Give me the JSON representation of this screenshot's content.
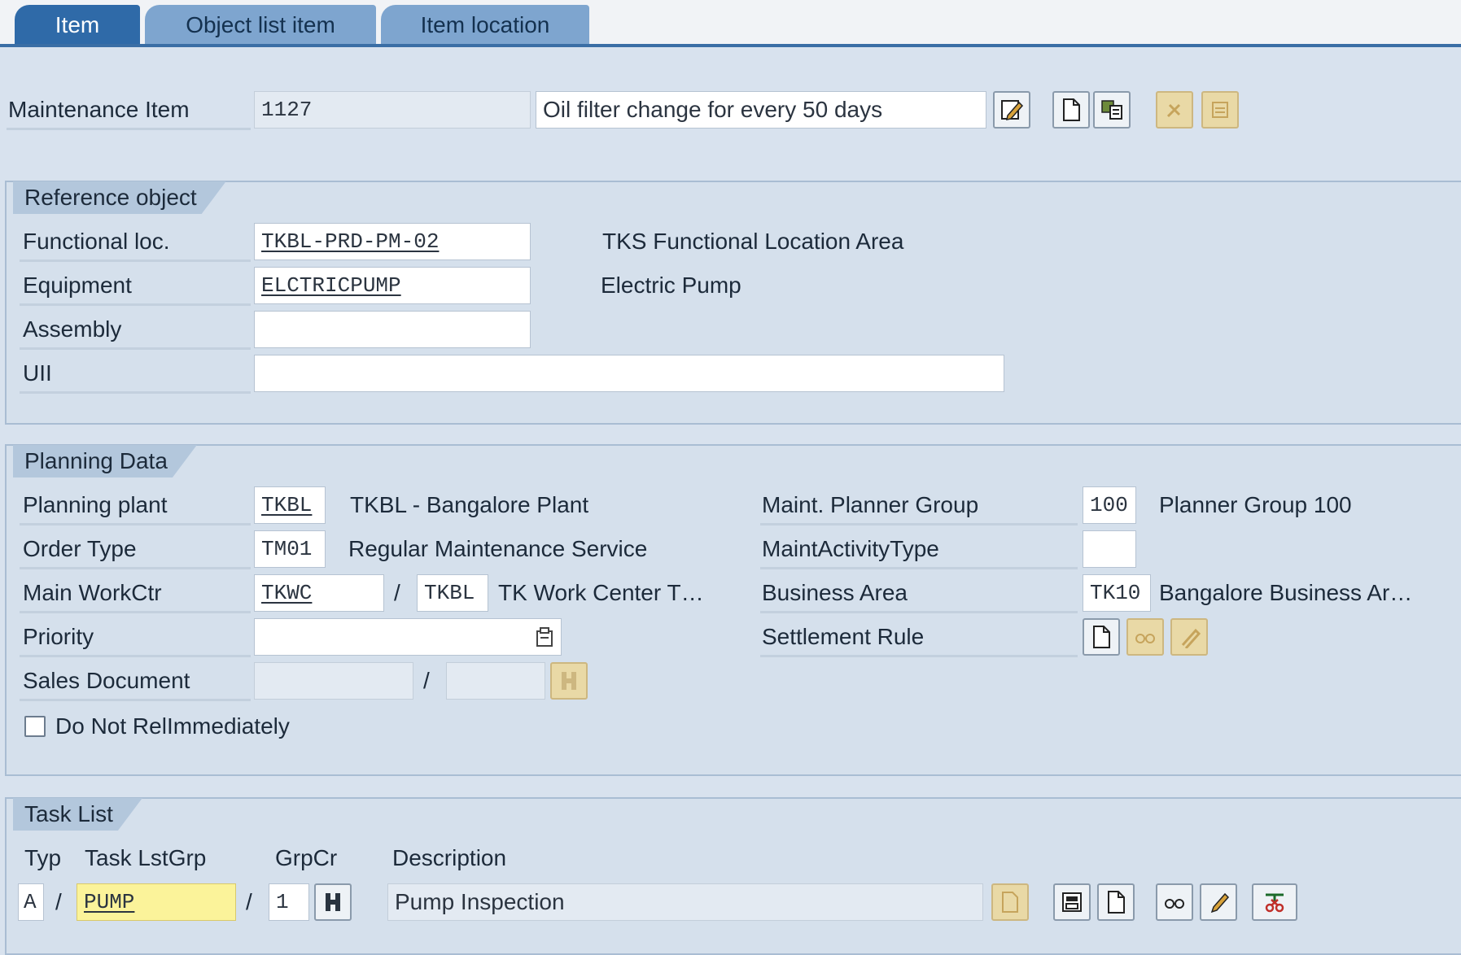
{
  "tabs": [
    {
      "label": "Item",
      "active": true
    },
    {
      "label": "Object list item",
      "active": false
    },
    {
      "label": "Item location",
      "active": false
    }
  ],
  "header": {
    "item_label": "Maintenance Item",
    "item_number": "1127",
    "item_description": "Oil filter change for every 50 days"
  },
  "reference_object": {
    "title": "Reference object",
    "functional_loc_label": "Functional loc.",
    "functional_loc_value": "TKBL-PRD-PM-02",
    "functional_loc_desc": "TKS Functional Location Area",
    "equipment_label": "Equipment",
    "equipment_value": "ELCTRICPUMP",
    "equipment_desc": "Electric Pump",
    "assembly_label": "Assembly",
    "assembly_value": "",
    "uii_label": "UII",
    "uii_value": ""
  },
  "planning_data": {
    "title": "Planning Data",
    "planning_plant_label": "Planning plant",
    "planning_plant_value": "TKBL",
    "planning_plant_desc": "TKBL - Bangalore Plant",
    "order_type_label": "Order Type",
    "order_type_value": "TM01",
    "order_type_desc": "Regular Maintenance Service",
    "main_workctr_label": "Main WorkCtr",
    "main_workctr_value": "TKWC",
    "main_workctr_plant": "TKBL",
    "main_workctr_desc": "TK Work Center T…",
    "priority_label": "Priority",
    "priority_value": "",
    "sales_document_label": "Sales Document",
    "sales_document_value": "",
    "sales_document_item": "",
    "do_not_rel_label": "Do Not RelImmediately",
    "do_not_rel_checked": false,
    "planner_group_label": "Maint. Planner Group",
    "planner_group_value": "100",
    "planner_group_desc": "Planner Group 100",
    "activity_type_label": "MaintActivityType",
    "activity_type_value": "",
    "business_area_label": "Business Area",
    "business_area_value": "TK10",
    "business_area_desc": "Bangalore Business Ar…",
    "settlement_rule_label": "Settlement Rule"
  },
  "task_list": {
    "title": "Task List",
    "typ_header": "Typ",
    "group_header": "Task LstGrp",
    "grpcr_header": "GrpCr",
    "description_header": "Description",
    "typ_value": "A",
    "group_value": "PUMP",
    "grpcr_value": "1",
    "description_value": "Pump Inspection"
  },
  "separator": "/",
  "icons": {
    "edit": "edit-pencil-icon",
    "create": "create-document-icon",
    "display": "display-object-icon",
    "search_help": "search-help-icon",
    "priority_dropdown": "dropdown-list-icon"
  }
}
